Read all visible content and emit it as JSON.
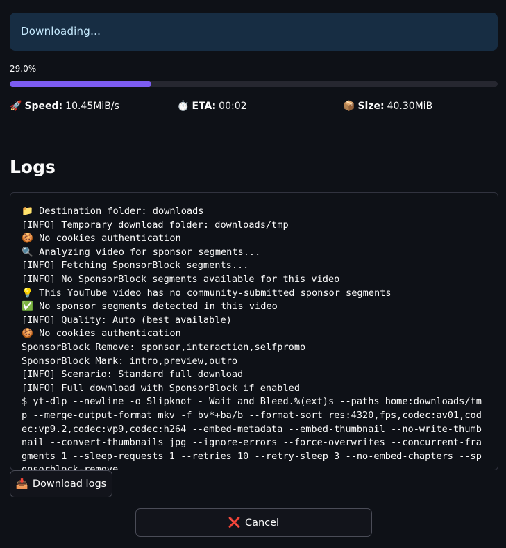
{
  "status": {
    "message": "Downloading…"
  },
  "progress": {
    "label": "29.0%",
    "fraction": 0.29,
    "fill_color": "#7c5cf2"
  },
  "metrics": {
    "speed": {
      "icon": "🚀",
      "label": "Speed:",
      "value": "10.45MiB/s"
    },
    "eta": {
      "icon": "⏱️",
      "label": "ETA:",
      "value": "00:02"
    },
    "size": {
      "icon": "📦",
      "label": "Size:",
      "value": "40.30MiB"
    }
  },
  "logs": {
    "heading": "Logs",
    "lines": [
      "📁 Destination folder: downloads",
      "[INFO] Temporary download folder: downloads/tmp",
      "🍪 No cookies authentication",
      "🔍 Analyzing video for sponsor segments...",
      "[INFO] Fetching SponsorBlock segments...",
      "[INFO] No SponsorBlock segments available for this video",
      "💡 This YouTube video has no community-submitted sponsor segments",
      "✅ No sponsor segments detected in this video",
      "[INFO] Quality: Auto (best available)",
      "🍪 No cookies authentication",
      "SponsorBlock Remove: sponsor,interaction,selfpromo",
      "SponsorBlock Mark: intro,preview,outro",
      "[INFO] Scenario: Standard full download",
      "[INFO] Full download with SponsorBlock if enabled",
      "$ yt-dlp --newline -o Slipknot - Wait and Bleed.%(ext)s --paths home:downloads/tmp --merge-output-format mkv -f bv*+ba/b --format-sort res:4320,fps,codec:av01,codec:vp9.2,codec:vp9,codec:h264 --embed-metadata --embed-thumbnail --no-write-thumbnail --convert-thumbnails jpg --ignore-errors --force-overwrites --concurrent-fragments 1 --sleep-requests 1 --retries 10 --retry-sleep 3 --no-embed-chapters --sponsorblock-remove"
    ]
  },
  "buttons": {
    "download_logs": {
      "icon": "📥",
      "label": "Download logs"
    },
    "cancel": {
      "icon": "❌",
      "label": "Cancel"
    }
  }
}
